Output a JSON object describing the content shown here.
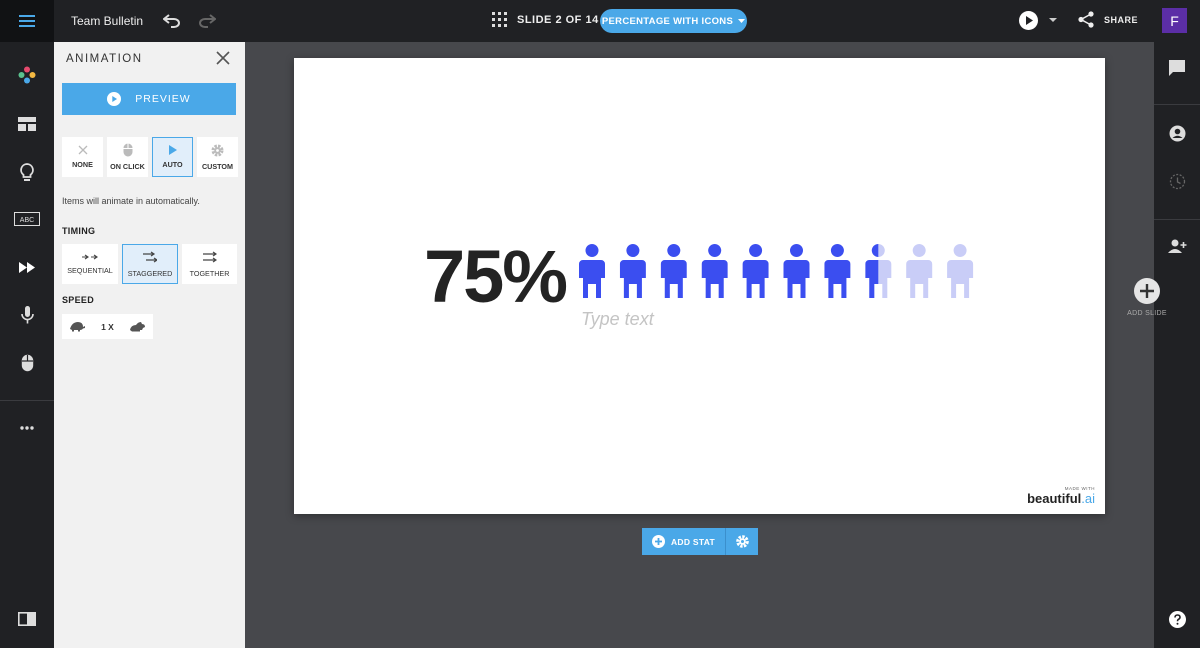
{
  "topbar": {
    "doc_title": "Team Bulletin",
    "slide_indicator": "SLIDE 2 OF 14",
    "layout_button": "PERCENTAGE WITH ICONS",
    "share_label": "SHARE",
    "avatar_initial": "F"
  },
  "left_rail": {
    "items": [
      "theme-icon",
      "layout-icon",
      "lightbulb-icon",
      "abc-icon",
      "animation-icon",
      "microphone-icon",
      "mouse-icon",
      "more-icon",
      "panel-toggle-icon"
    ],
    "abc_label": "ABC"
  },
  "panel": {
    "title": "ANIMATION",
    "preview_label": "PREVIEW",
    "modes": [
      {
        "label": "NONE",
        "active": false
      },
      {
        "label": "ON CLICK",
        "active": false
      },
      {
        "label": "AUTO",
        "active": true
      },
      {
        "label": "CUSTOM",
        "active": false
      }
    ],
    "description": "Items will animate in automatically.",
    "timing_label": "TIMING",
    "timings": [
      {
        "label": "SEQUENTIAL",
        "active": false
      },
      {
        "label": "STAGGERED",
        "active": true
      },
      {
        "label": "TOGETHER",
        "active": false
      }
    ],
    "speed_label": "SPEED",
    "speed_value": "1 X"
  },
  "slide": {
    "stat_value": "75%",
    "percent": 75,
    "icon_count": 10,
    "icon_color": "#3b4ef0",
    "icon_faded_color": "#c9cdf7",
    "placeholder": "Type text",
    "brand_small": "MADE WITH",
    "brand_logo_main": "beautiful",
    "brand_logo_suffix": ".ai"
  },
  "addstat": {
    "label": "ADD STAT"
  },
  "right_rail": {
    "add_slide_label": "ADD SLIDE"
  },
  "colors": {
    "accent": "#4aa8e8",
    "dark": "#202124",
    "canvas": "#47484c"
  }
}
